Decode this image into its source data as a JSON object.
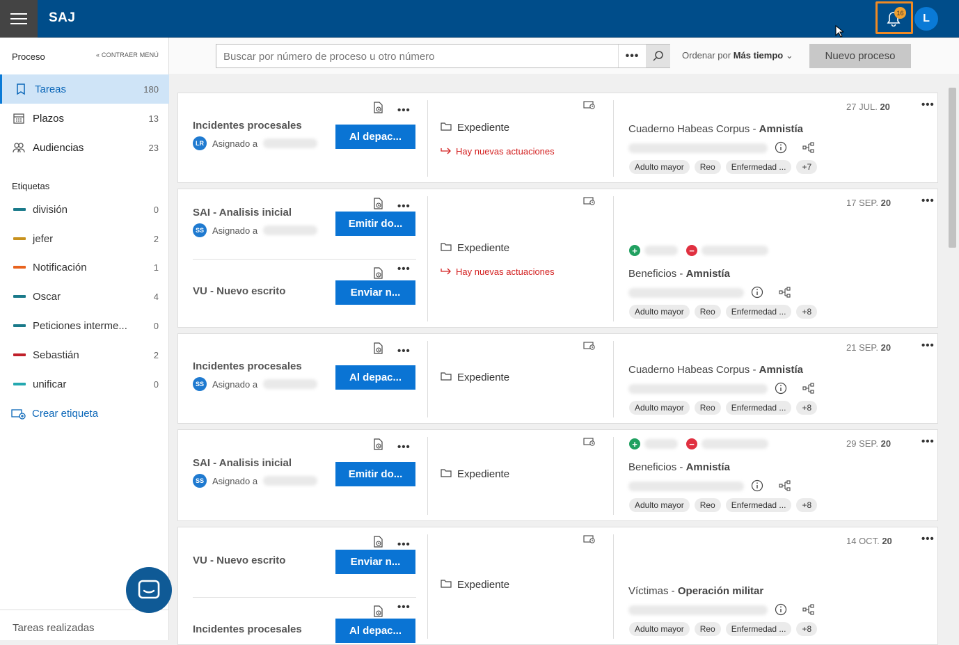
{
  "app": {
    "title": "SAJ",
    "notifications": "16",
    "user_initial": "L"
  },
  "sidebar": {
    "header": "Proceso",
    "collapse": "CONTRAER MENÚ",
    "items": [
      {
        "label": "Tareas",
        "count": "180"
      },
      {
        "label": "Plazos",
        "count": "13"
      },
      {
        "label": "Audiencias",
        "count": "23"
      }
    ],
    "tags_header": "Etiquetas",
    "tags": [
      {
        "label": "división",
        "count": "0",
        "color": "#1a7a8a"
      },
      {
        "label": "jefer",
        "count": "2",
        "color": "#c8921e"
      },
      {
        "label": "Notificación",
        "count": "1",
        "color": "#e8631e"
      },
      {
        "label": "Oscar",
        "count": "4",
        "color": "#1a7a8a"
      },
      {
        "label": "Peticiones interme...",
        "count": "0",
        "color": "#1a7a8a"
      },
      {
        "label": "Sebastián",
        "count": "2",
        "color": "#c0202a"
      },
      {
        "label": "unificar",
        "count": "0",
        "color": "#24a8b0"
      }
    ],
    "create_tag": "Crear etiqueta",
    "done": "Tareas realizadas"
  },
  "toolbar": {
    "search_placeholder": "Buscar por número de proceso u otro número",
    "more": "•••",
    "sort_prefix": "Ordenar por",
    "sort_value": "Más tiempo",
    "new_process": "Nuevo proceso"
  },
  "common": {
    "assigned": "Asignado a",
    "expediente": "Expediente",
    "novedades": "Hay nuevas actuaciones",
    "dots": "•••"
  },
  "cards": [
    {
      "tasks": [
        {
          "title": "Incidentes procesales",
          "initials": "LR",
          "action": "Al depac..."
        }
      ],
      "new_actions": true,
      "date_day": "27 JUL.",
      "date_year": "20",
      "case_prefix": "Cuaderno Habeas Corpus",
      "case_bold": "Amnistía",
      "chips": [
        "Adulto mayor",
        "Reo",
        "Enfermedad ...",
        "+7"
      ]
    },
    {
      "tasks": [
        {
          "title": "SAI - Analisis inicial",
          "initials": "SS",
          "action": "Emitir do..."
        },
        {
          "title": "VU - Nuevo escrito",
          "action": "Enviar n..."
        }
      ],
      "new_actions": true,
      "date_day": "17 SEP.",
      "date_year": "20",
      "case_prefix": "Beneficios",
      "case_bold": "Amnistía",
      "chips": [
        "Adulto mayor",
        "Reo",
        "Enfermedad ...",
        "+8"
      ]
    },
    {
      "tasks": [
        {
          "title": "Incidentes procesales",
          "initials": "SS",
          "action": "Al depac..."
        }
      ],
      "new_actions": false,
      "date_day": "21 SEP.",
      "date_year": "20",
      "case_prefix": "Cuaderno Habeas Corpus",
      "case_bold": "Amnistía",
      "chips": [
        "Adulto mayor",
        "Reo",
        "Enfermedad ...",
        "+8"
      ]
    },
    {
      "tasks": [
        {
          "title": "SAI - Analisis inicial",
          "initials": "SS",
          "action": "Emitir do..."
        }
      ],
      "new_actions": false,
      "date_day": "29 SEP.",
      "date_year": "20",
      "case_prefix": "Beneficios",
      "case_bold": "Amnistía",
      "chips": [
        "Adulto mayor",
        "Reo",
        "Enfermedad ...",
        "+8"
      ]
    },
    {
      "tasks": [
        {
          "title": "VU - Nuevo escrito",
          "action": "Enviar n..."
        },
        {
          "title": "Incidentes procesales",
          "action": "Al depac..."
        }
      ],
      "new_actions": false,
      "date_day": "14 OCT.",
      "date_year": "20",
      "case_prefix": "Víctimas",
      "case_bold": "Operación militar",
      "chips": [
        "Adulto mayor",
        "Reo",
        "Enfermedad ...",
        "+8"
      ]
    }
  ]
}
